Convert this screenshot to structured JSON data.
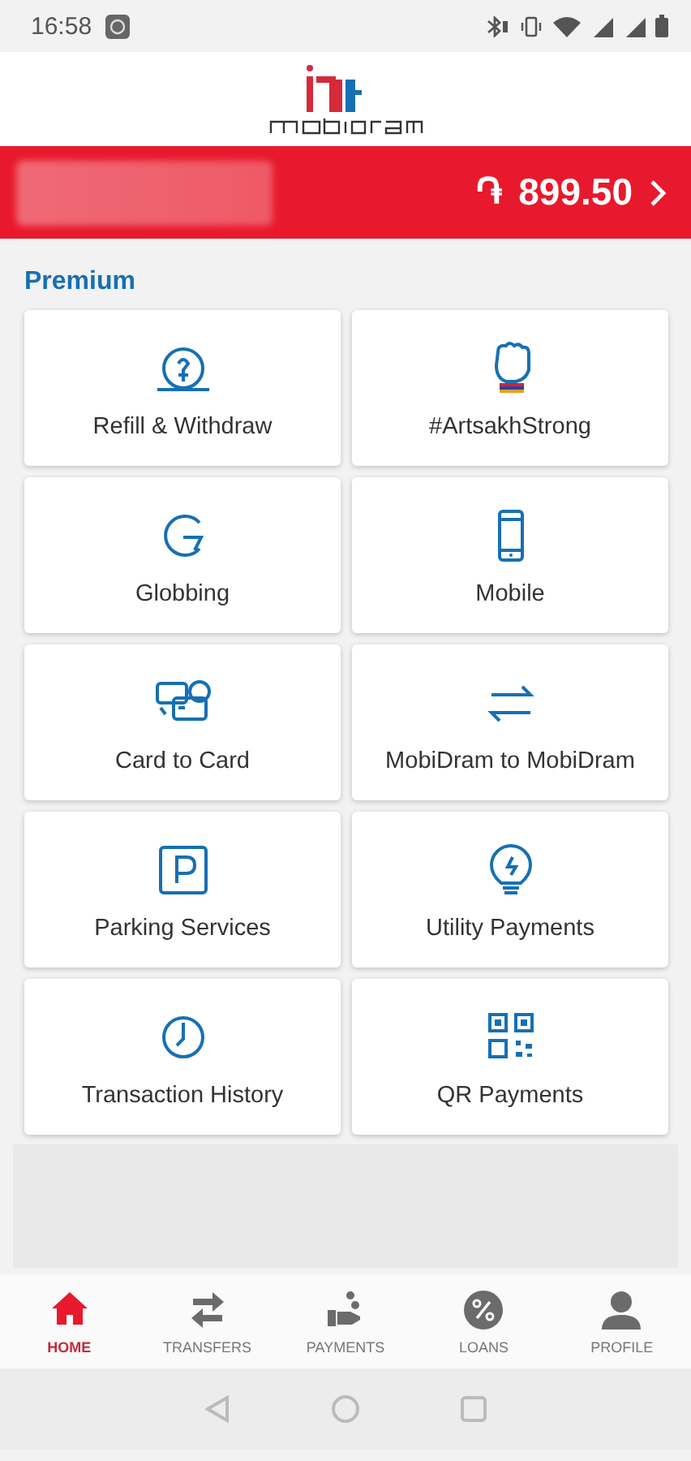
{
  "status_bar": {
    "time": "16:58"
  },
  "balance": {
    "currency": "֏",
    "amount": "899.50"
  },
  "section_title": "Premium",
  "services": [
    {
      "label": "Refill & Withdraw"
    },
    {
      "label": "#ArtsakhStrong"
    },
    {
      "label": "Globbing"
    },
    {
      "label": "Mobile"
    },
    {
      "label": "Card to Card"
    },
    {
      "label": "MobiDram to MobiDram"
    },
    {
      "label": "Parking Services"
    },
    {
      "label": "Utility Payments"
    },
    {
      "label": "Transaction History"
    },
    {
      "label": "QR Payments"
    }
  ],
  "bottom_nav": [
    {
      "label": "HOME",
      "selected": true
    },
    {
      "label": "TRANSFERS",
      "selected": false
    },
    {
      "label": "PAYMENTS",
      "selected": false
    },
    {
      "label": "LOANS",
      "selected": false
    },
    {
      "label": "PROFILE",
      "selected": false
    }
  ]
}
